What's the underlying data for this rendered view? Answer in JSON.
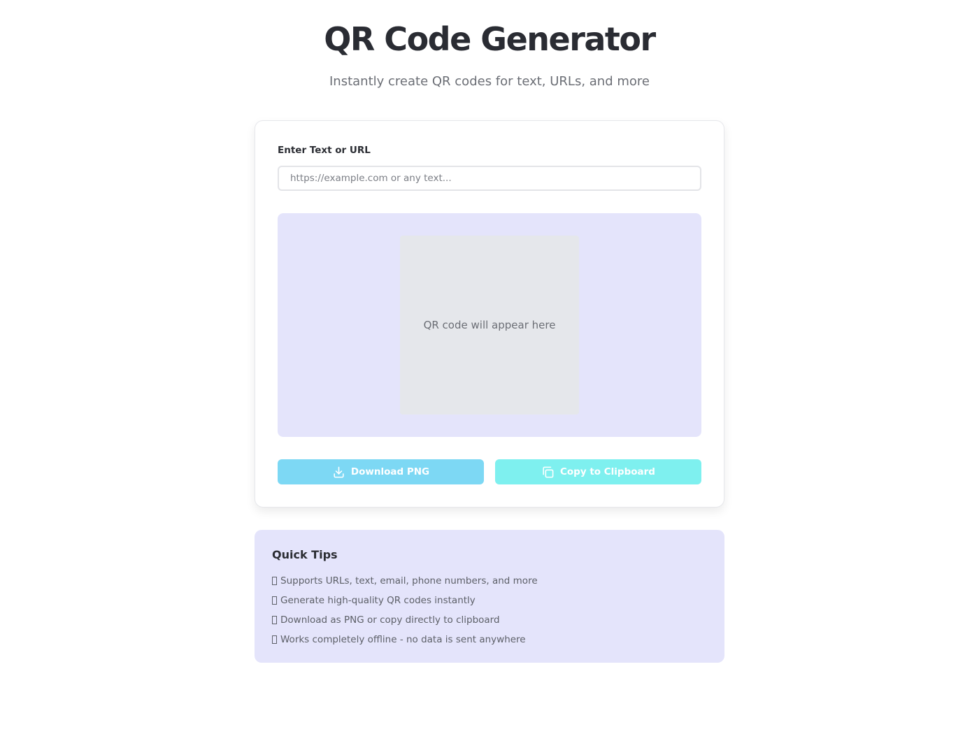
{
  "header": {
    "title": "QR Code Generator",
    "subtitle": "Instantly create QR codes for text, URLs, and more"
  },
  "form": {
    "label": "Enter Text or URL",
    "input_value": "",
    "input_placeholder": "https://example.com or any text..."
  },
  "preview": {
    "placeholder_text": "QR code will appear here"
  },
  "actions": {
    "download_label": "Download PNG",
    "download_icon": "download-icon",
    "copy_label": "Copy to Clipboard",
    "copy_icon": "copy-icon"
  },
  "tips": {
    "title": "Quick Tips",
    "items": [
      "Supports URLs, text, email, phone numbers, and more",
      "Generate high-quality QR codes instantly",
      "Download as PNG or copy directly to clipboard",
      "Works completely offline - no data is sent anywhere"
    ]
  },
  "colors": {
    "download_button": "#7dd8f4",
    "copy_button": "#7ef0ef",
    "preview_background": "#e4e4fb",
    "qr_placeholder": "#e5e7eb"
  }
}
